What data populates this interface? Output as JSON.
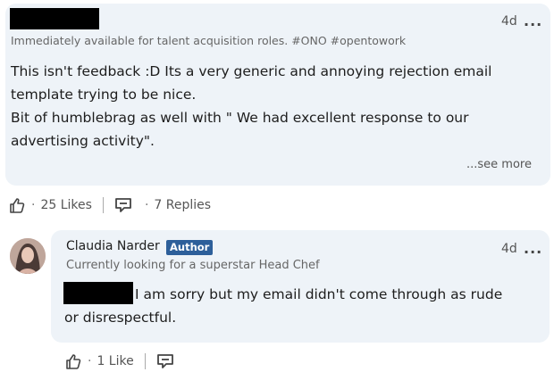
{
  "comment1": {
    "time": "4d",
    "menu": "...",
    "headline": "Immediately available for talent acquisition roles. #ONO #opentowork",
    "body_lines": [
      "This isn't feedback :D Its a very generic and annoying rejection email",
      "template trying to be nice.",
      "Bit of humblebrag as well with \" We had excellent response to our",
      "advertising activity\"."
    ],
    "see_more": "...see more",
    "likes": "25 Likes",
    "replies": "7 Replies"
  },
  "comment2": {
    "author": "Claudia Narder",
    "badge": "Author",
    "headline": "Currently looking for a superstar Head Chef",
    "time": "4d",
    "menu": "...",
    "body_line1": "I am sorry but my email didn't come through as rude",
    "body_line2": "or disrespectful.",
    "likes": "1 Like"
  },
  "colors": {
    "bubble": "#eef3f8",
    "badge": "#2d5f9a"
  },
  "icons": [
    "thumbs-up-icon",
    "reply-icon"
  ]
}
